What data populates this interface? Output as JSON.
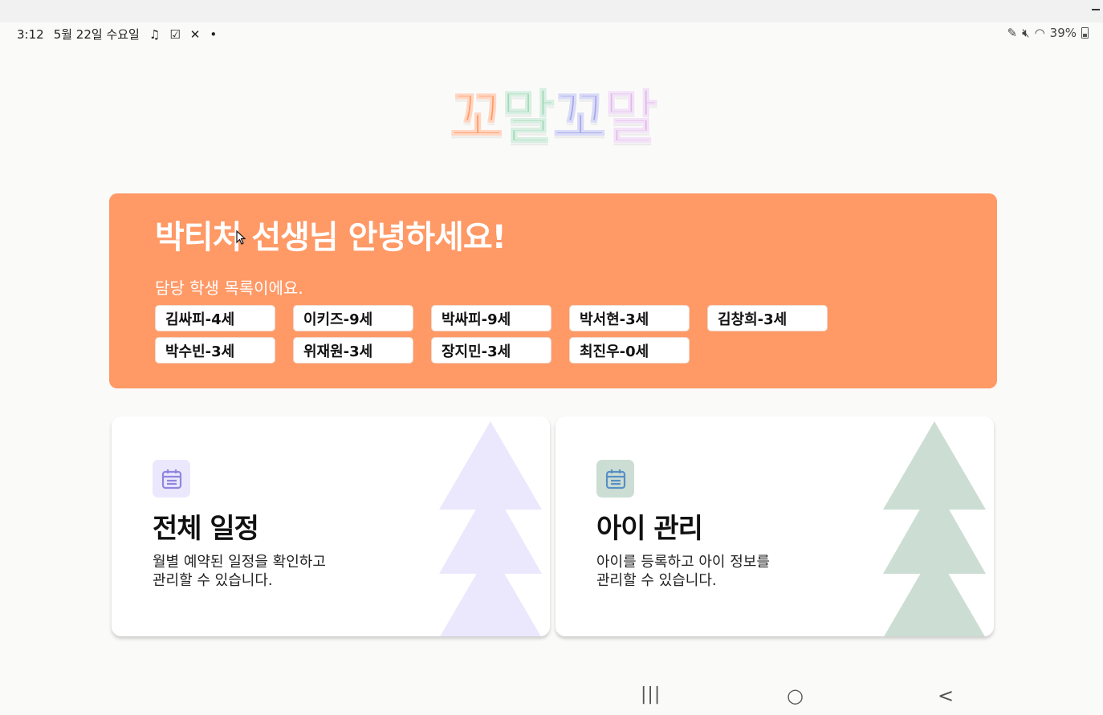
{
  "status_bar": {
    "time": "3:12",
    "date": "5월 22일 수요일",
    "battery": "39%"
  },
  "logo": {
    "chars": [
      {
        "char": "꼬",
        "color": "#ff9966"
      },
      {
        "char": "말",
        "color": "#9fd8b6"
      },
      {
        "char": "꼬",
        "color": "#a3a6e8"
      },
      {
        "char": "말",
        "color": "#e0b8ea"
      }
    ]
  },
  "greeting": {
    "title": "박티처 선생님 안녕하세요!",
    "subtitle": "담당 학생 목록이에요.",
    "background": "#ff9966"
  },
  "students": [
    "김싸피-4세",
    "이키즈-9세",
    "박싸피-9세",
    "박서현-3세",
    "김창희-3세",
    "박수빈-3세",
    "위재원-3세",
    "장지민-3세",
    "최진우-0세"
  ],
  "cards": {
    "schedule": {
      "title": "전체 일정",
      "description": "월별 예약된 일정을 확인하고\n관리할 수 있습니다.",
      "icon": "calendar-icon",
      "accent": "#ebe8fd",
      "icon_color": "#8f86df"
    },
    "kids": {
      "title": "아이 관리",
      "description": "아이를 등록하고 아이 정보를\n관리할 수 있습니다.",
      "icon": "calendar-icon",
      "accent": "#ccded4",
      "icon_color": "#5a8fc4"
    }
  },
  "nav": {
    "recents": "|||",
    "home": "○",
    "back": "<"
  }
}
